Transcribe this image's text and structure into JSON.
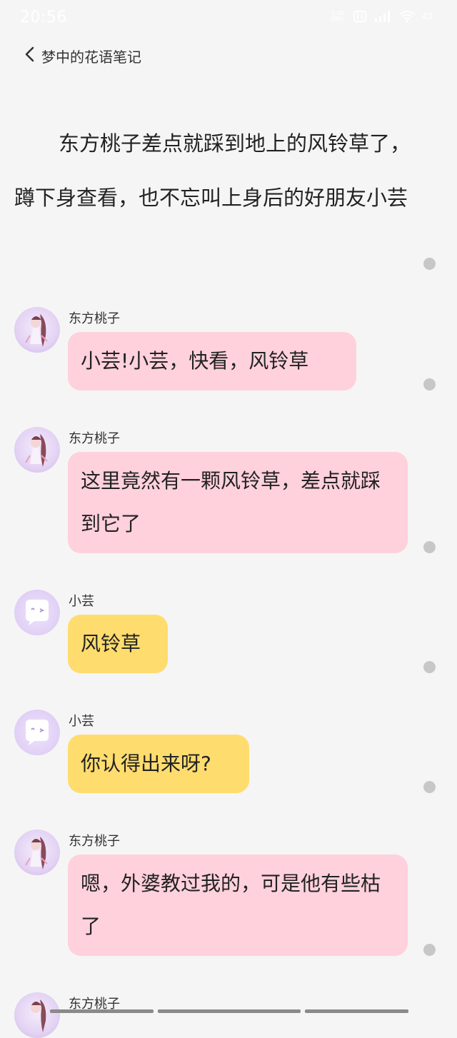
{
  "status": {
    "time": "20:56",
    "net_speed_top": "0.00",
    "net_speed_bottom": "KB/s",
    "signal_label": "4G",
    "battery": "43"
  },
  "header": {
    "title": "梦中的花语笔记"
  },
  "narration": {
    "text": "东方桃子差点就踩到地上的风铃草了，蹲下身查看，也不忘叫上身后的好朋友小芸"
  },
  "messages": [
    {
      "sender": "东方桃子",
      "text": "小芸!小芸，快看，风铃草"
    },
    {
      "sender": "东方桃子",
      "text": "这里竟然有一颗风铃草，差点就踩到它了"
    },
    {
      "sender": "小芸",
      "text": "风铃草"
    },
    {
      "sender": "小芸",
      "text": "你认得出来呀?"
    },
    {
      "sender": "东方桃子",
      "text": "嗯，外婆教过我的，可是他有些枯了"
    },
    {
      "sender": "东方桃子",
      "text": ""
    }
  ],
  "colors": {
    "background": "#f5f5f5",
    "peach_bubble": "#ffd1dc",
    "yun_bubble": "#ffdc6e",
    "avatar_purple": "#cdb4ea"
  },
  "icons": {
    "back": "chevron-left-icon",
    "more": "dot-icon",
    "peach_avatar": "anime-girl-avatar",
    "yun_avatar": "chat-face-avatar"
  }
}
